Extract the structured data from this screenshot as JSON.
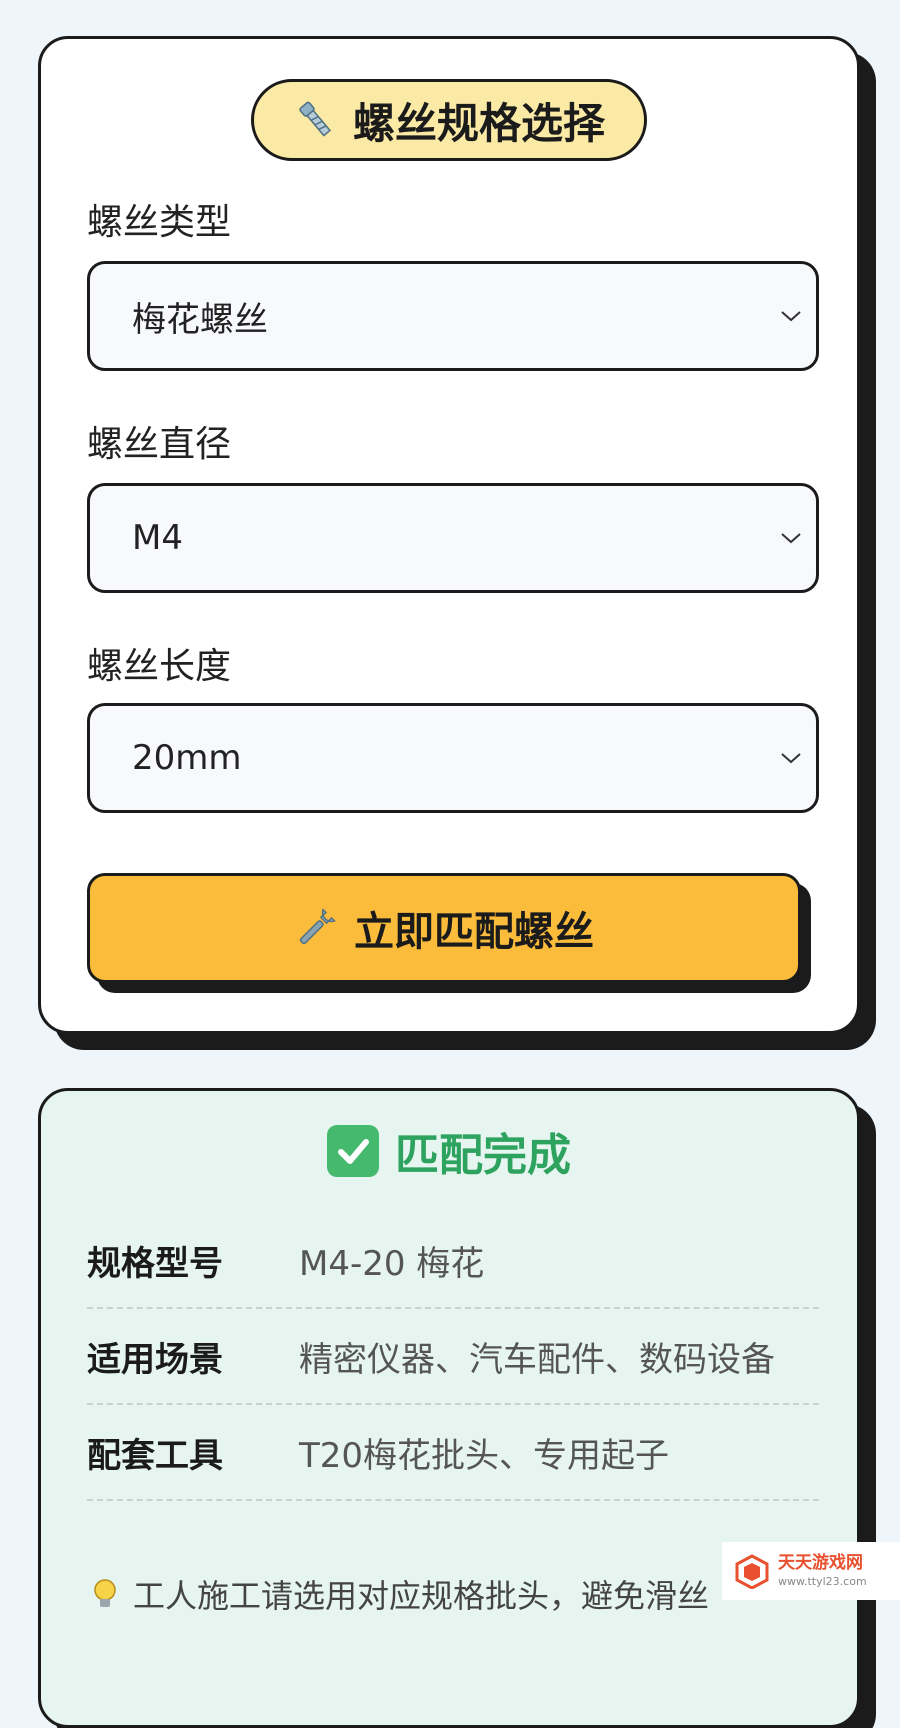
{
  "spec_card": {
    "title": "螺丝规格选择",
    "title_icon": "bolt-icon",
    "fields": [
      {
        "label": "螺丝类型",
        "value": "梅花螺丝"
      },
      {
        "label": "螺丝直径",
        "value": "M4"
      },
      {
        "label": "螺丝长度",
        "value": "20mm"
      }
    ],
    "match_button": {
      "label": "立即匹配螺丝",
      "icon": "wrench-icon"
    }
  },
  "result_card": {
    "title": "匹配完成",
    "title_icon": "check-icon",
    "rows": [
      {
        "key": "规格型号",
        "value": "M4-20 梅花"
      },
      {
        "key": "适用场景",
        "value": "精密仪器、汽车配件、数码设备"
      },
      {
        "key": "配套工具",
        "value": "T20梅花批头、专用起子"
      }
    ],
    "tip": "工人施工请选用对应规格批头，避免滑丝",
    "tip_icon": "bulb-icon"
  },
  "watermark": {
    "name": "天天游戏网",
    "url": "www.ttyl23.com"
  },
  "colors": {
    "background": "#eef6fc",
    "title_pill": "#fbe9a6",
    "button": "#fbbc3c",
    "result_card": "#e6f5ef",
    "success": "#2ea35f",
    "outline": "#1b1b1b"
  }
}
